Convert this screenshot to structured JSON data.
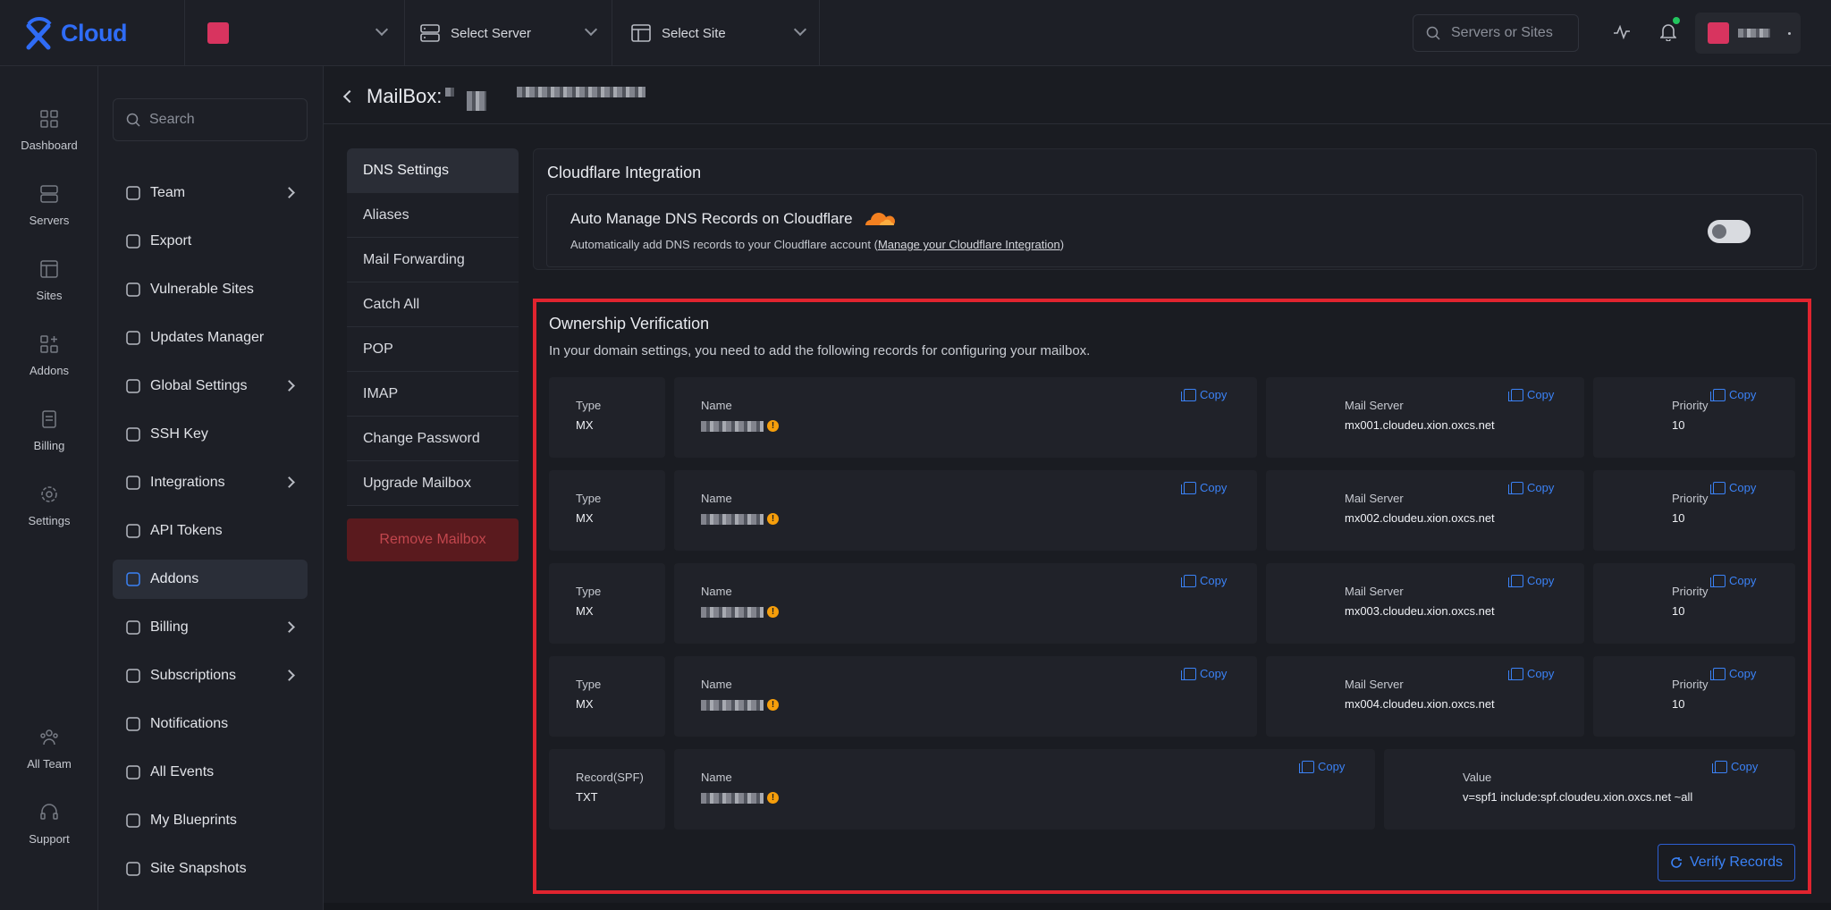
{
  "brand": {
    "name": "Cloud",
    "accent": "#2f6cf6"
  },
  "topbar": {
    "server_placeholder": "Select Server",
    "site_placeholder": "Select Site",
    "search_placeholder": "Servers or Sites",
    "colors": {
      "avatar": "#d8345f",
      "notification_dot": "#22c55e"
    }
  },
  "rail": [
    {
      "label": "Dashboard",
      "icon": "dashboard-icon"
    },
    {
      "label": "Servers",
      "icon": "server-icon"
    },
    {
      "label": "Sites",
      "icon": "sites-icon"
    },
    {
      "label": "Addons",
      "icon": "addons-icon"
    },
    {
      "label": "Billing",
      "icon": "billing-icon"
    },
    {
      "label": "Settings",
      "icon": "gear-icon"
    },
    {
      "label": "All Team",
      "icon": "team-icon"
    },
    {
      "label": "Support",
      "icon": "headset-icon"
    }
  ],
  "sidebar": {
    "search_placeholder": "Search",
    "items": [
      {
        "label": "Team",
        "icon": "team-icon",
        "has_arrow": true
      },
      {
        "label": "Export",
        "icon": "download-icon",
        "has_arrow": false
      },
      {
        "label": "Vulnerable Sites",
        "icon": "bug-icon",
        "has_arrow": false
      },
      {
        "label": "Updates Manager",
        "icon": "wordpress-icon",
        "has_arrow": false
      },
      {
        "label": "Global Settings",
        "icon": "cloud-gear-icon",
        "has_arrow": true
      },
      {
        "label": "SSH Key",
        "icon": "key-icon",
        "has_arrow": false
      },
      {
        "label": "Integrations",
        "icon": "gear-icon",
        "has_arrow": true
      },
      {
        "label": "API Tokens",
        "icon": "key-icon",
        "has_arrow": false
      },
      {
        "label": "Addons",
        "icon": "puzzle-icon",
        "has_arrow": false,
        "active": true
      },
      {
        "label": "Billing",
        "icon": "receipt-icon",
        "has_arrow": true
      },
      {
        "label": "Subscriptions",
        "icon": "subscription-icon",
        "has_arrow": true
      },
      {
        "label": "Notifications",
        "icon": "bell-icon",
        "has_arrow": false
      },
      {
        "label": "All Events",
        "icon": "activity-icon",
        "has_arrow": false
      },
      {
        "label": "My Blueprints",
        "icon": "blueprint-icon",
        "has_arrow": false
      },
      {
        "label": "Site Snapshots",
        "icon": "snapshot-icon",
        "has_arrow": false
      }
    ]
  },
  "page": {
    "title": "MailBox:"
  },
  "tabs": [
    {
      "label": "DNS Settings",
      "active": true
    },
    {
      "label": "Aliases"
    },
    {
      "label": "Mail Forwarding"
    },
    {
      "label": "Catch All"
    },
    {
      "label": "POP"
    },
    {
      "label": "IMAP"
    },
    {
      "label": "Change Password"
    },
    {
      "label": "Upgrade Mailbox"
    }
  ],
  "remove_button": "Remove Mailbox",
  "cloudflare": {
    "heading": "Cloudflare Integration",
    "title": "Auto Manage DNS Records on Cloudflare",
    "sub_prefix": "Automatically add DNS records to your Cloudflare account (",
    "sub_link": "Manage your Cloudflare Integration",
    "sub_suffix": ")",
    "enabled": false
  },
  "ownership": {
    "heading": "Ownership Verification",
    "description": "In your domain settings, you need to add the following records for configuring your mailbox.",
    "copy_label": "Copy",
    "mx_records": [
      {
        "type_label": "Type",
        "type": "MX",
        "name_label": "Name",
        "server_label": "Mail Server",
        "server": "mx001.cloudeu.xion.oxcs.net",
        "priority_label": "Priority",
        "priority": "10"
      },
      {
        "type_label": "Type",
        "type": "MX",
        "name_label": "Name",
        "server_label": "Mail Server",
        "server": "mx002.cloudeu.xion.oxcs.net",
        "priority_label": "Priority",
        "priority": "10"
      },
      {
        "type_label": "Type",
        "type": "MX",
        "name_label": "Name",
        "server_label": "Mail Server",
        "server": "mx003.cloudeu.xion.oxcs.net",
        "priority_label": "Priority",
        "priority": "10"
      },
      {
        "type_label": "Type",
        "type": "MX",
        "name_label": "Name",
        "server_label": "Mail Server",
        "server": "mx004.cloudeu.xion.oxcs.net",
        "priority_label": "Priority",
        "priority": "10"
      }
    ],
    "spf_record": {
      "type_label": "Record(SPF)",
      "type": "TXT",
      "name_label": "Name",
      "value_label": "Value",
      "value": "v=spf1 include:spf.cloudeu.xion.oxcs.net ~all"
    },
    "verify_button": "Verify Records"
  }
}
